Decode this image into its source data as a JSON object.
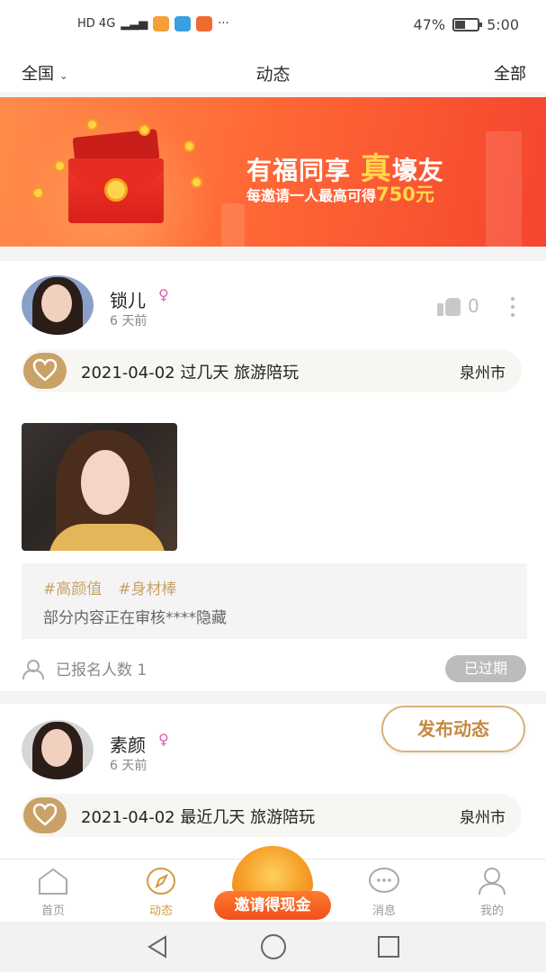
{
  "status_bar": {
    "network": "HD 4G",
    "more": "···",
    "battery": "47%",
    "time": "5:00"
  },
  "header": {
    "region": "全国",
    "title": "动态",
    "filter": "全部"
  },
  "banner": {
    "line1_a": "有福同享",
    "line1_highlight": "真",
    "line1_b": "壕友",
    "line2_a": "每邀请一人最高可得",
    "line2_amount": "750元"
  },
  "posts": [
    {
      "username": "锁儿",
      "time_ago": "6 天前",
      "likes": "0",
      "date": "2021-04-02",
      "when": "过几天",
      "activity": "旅游陪玩",
      "city": "泉州市",
      "tags": [
        "#高颜值",
        "#身材棒"
      ],
      "description": "部分内容正在审核****隐藏",
      "signup_label": "已报名人数",
      "signup_count": "1",
      "status": "已过期"
    },
    {
      "username": "素颜",
      "time_ago": "6 天前",
      "date": "2021-04-02",
      "when": "最近几天",
      "activity": "旅游陪玩",
      "city": "泉州市"
    }
  ],
  "publish_button": "发布动态",
  "tabbar": {
    "home": "首页",
    "moments": "动态",
    "invite": "邀请得现金",
    "messages": "消息",
    "mine": "我的",
    "active": "moments"
  },
  "colors": {
    "accent_gold": "#c8a266",
    "banner_orange": "#f5452e",
    "invite_orange": "#f0501c"
  }
}
